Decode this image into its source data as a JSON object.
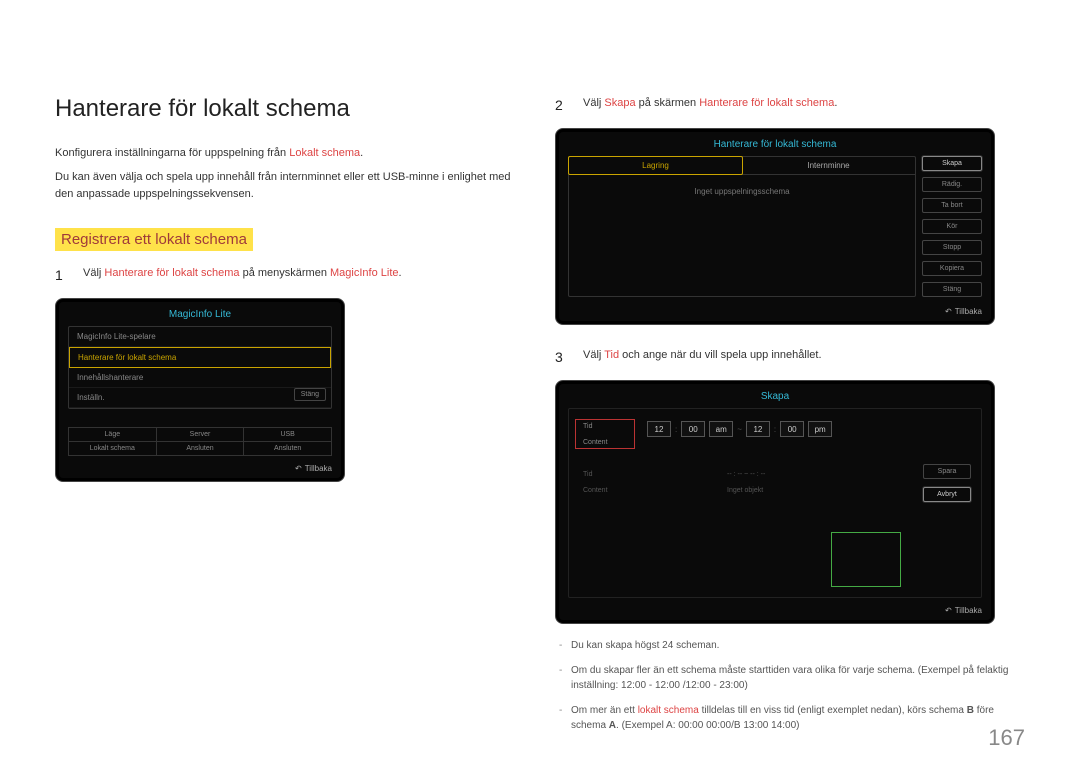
{
  "page": {
    "title": "Hanterare för lokalt schema",
    "intro1_pre": "Konfigurera inställningarna för uppspelning från ",
    "intro1_red": "Lokalt schema",
    "intro1_post": ".",
    "intro2": "Du kan även välja och spela upp innehåll från internminnet eller ett USB-minne i enlighet med den anpassade uppspelningssekvensen.",
    "subhead": "Registrera ett lokalt schema",
    "number": "167"
  },
  "steps": {
    "s1": {
      "num": "1",
      "pre": "Välj ",
      "red1": "Hanterare för lokalt schema",
      "mid": " på menyskärmen ",
      "red2": "MagicInfo Lite",
      "post": "."
    },
    "s2": {
      "num": "2",
      "pre": "Välj ",
      "red1": "Skapa",
      "mid": " på skärmen ",
      "red2": "Hanterare för lokalt schema",
      "post": "."
    },
    "s3": {
      "num": "3",
      "pre": "Välj ",
      "red1": "Tid",
      "post": " och ange när du vill spela upp innehållet."
    }
  },
  "mock1": {
    "title": "MagicInfo Lite",
    "rows": {
      "r0": "MagicInfo Lite-spelare",
      "r1": "Hanterare för lokalt schema",
      "r2": "Innehållshanterare",
      "r3": "Inställn."
    },
    "sidebtn": "Stäng",
    "table": {
      "a1": "Läge",
      "a2": "Server",
      "a3": "USB",
      "b1": "Lokalt schema",
      "b2": "Ansluten",
      "b3": "Ansluten"
    },
    "back": "Tillbaka"
  },
  "mock2": {
    "title": "Hanterare för lokalt schema",
    "tab1": "Lagring",
    "tab2": "Internminne",
    "center": "Inget uppspelningsschema",
    "buttons": {
      "b0": "Skapa",
      "b1": "Rädig.",
      "b2": "Ta bort",
      "b3": "Kör",
      "b4": "Stopp",
      "b5": "Kopiera",
      "b6": "Stäng"
    },
    "back": "Tillbaka"
  },
  "mock3": {
    "title": "Skapa",
    "row1_label": "Tid",
    "row2_label": "Content",
    "time": {
      "h1": "12",
      "m1": "00",
      "ap1": "am",
      "sep": "~",
      "h2": "12",
      "m2": "00",
      "ap2": "pm"
    },
    "g1": "Tid",
    "g1v": "-- : -- ~  -- : --",
    "g2": "Content",
    "g2v": "Inget objekt",
    "side": {
      "s1": "Spara",
      "s2": "Avbryt"
    },
    "back": "Tillbaka"
  },
  "notes": {
    "n1": "Du kan skapa högst 24 scheman.",
    "n2": "Om du skapar fler än ett schema måste starttiden vara olika för varje schema. (Exempel på felaktig inställning: 12:00 - 12:00 /12:00 - 23:00)",
    "n3_pre": "Om mer än ett ",
    "n3_red": "lokalt schema",
    "n3_mid": " tilldelas till en viss tid (enligt exemplet nedan), körs schema ",
    "n3_b": "B",
    "n3_mid2": " före schema ",
    "n3_a": "A",
    "n3_post": ". (Exempel A: 00:00 00:00/B 13:00 14:00)"
  }
}
